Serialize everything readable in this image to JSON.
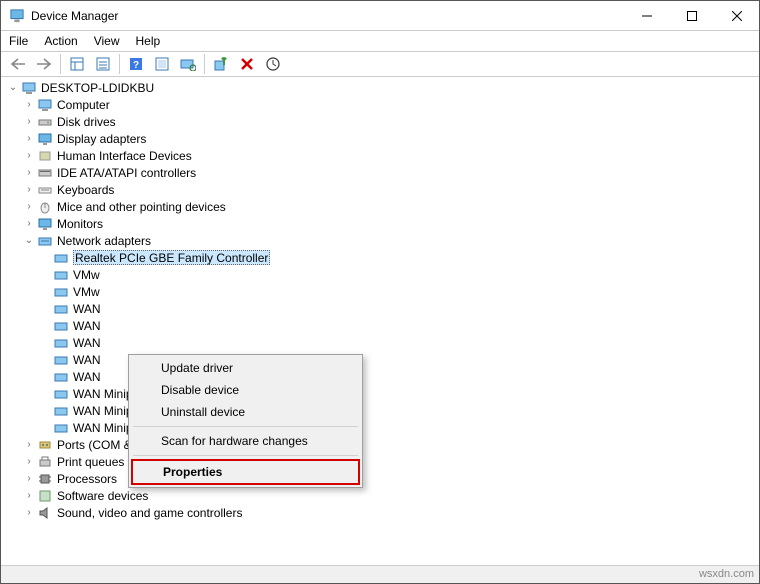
{
  "window": {
    "title": "Device Manager"
  },
  "menu": {
    "file": "File",
    "action": "Action",
    "view": "View",
    "help": "Help"
  },
  "tree": {
    "root": "DESKTOP-LDIDKBU",
    "groups": [
      {
        "label": "Computer",
        "icon": "computer-icon"
      },
      {
        "label": "Disk drives",
        "icon": "disk-icon"
      },
      {
        "label": "Display adapters",
        "icon": "display-icon"
      },
      {
        "label": "Human Interface Devices",
        "icon": "hid-icon"
      },
      {
        "label": "IDE ATA/ATAPI controllers",
        "icon": "ide-icon"
      },
      {
        "label": "Keyboards",
        "icon": "keyboard-icon"
      },
      {
        "label": "Mice and other pointing devices",
        "icon": "mouse-icon"
      },
      {
        "label": "Monitors",
        "icon": "monitor-icon"
      }
    ],
    "network": {
      "label": "Network adapters",
      "selected": "Realtek PCIe GBE Family Controller",
      "others": [
        "VMw",
        "VMw",
        "WAN",
        "WAN",
        "WAN",
        "WAN",
        "WAN"
      ],
      "after": [
        "WAN Miniport (PPPOE)",
        "WAN Miniport (PPTP)",
        "WAN Miniport (SSTP)"
      ]
    },
    "after_network": [
      {
        "label": "Ports (COM & LPT)",
        "icon": "port-icon"
      },
      {
        "label": "Print queues",
        "icon": "printer-icon"
      },
      {
        "label": "Processors",
        "icon": "cpu-icon"
      },
      {
        "label": "Software devices",
        "icon": "software-icon"
      },
      {
        "label": "Sound, video and game controllers",
        "icon": "sound-icon"
      }
    ]
  },
  "context_menu": {
    "update": "Update driver",
    "disable": "Disable device",
    "uninstall": "Uninstall device",
    "scan": "Scan for hardware changes",
    "properties": "Properties"
  },
  "watermark": "wsxdn.com"
}
